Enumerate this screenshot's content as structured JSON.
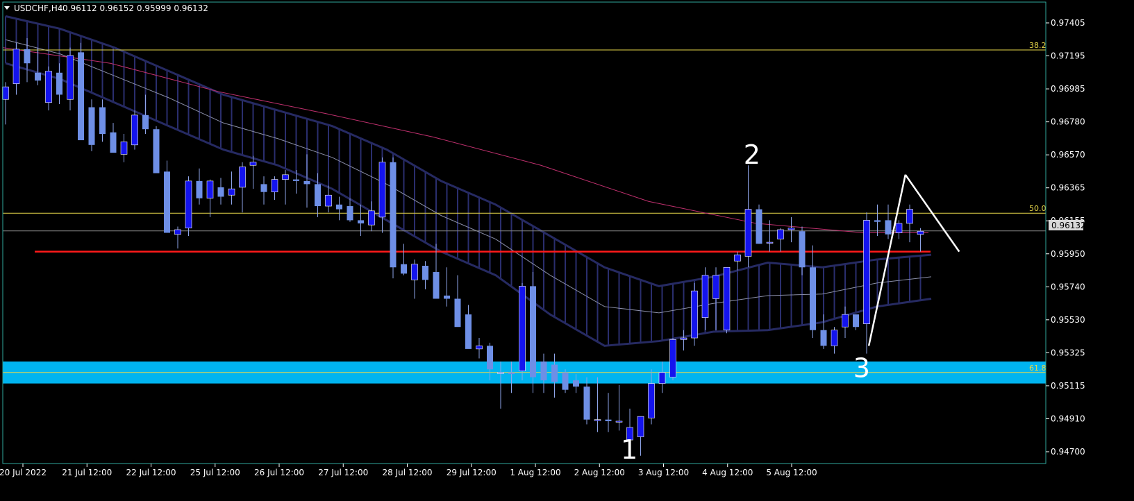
{
  "header": {
    "symbol": "USDCHF,H4",
    "prices": "0.96112 0.96152 0.95999 0.96132"
  },
  "colors": {
    "background": "#000000",
    "frame": "#2fa89b",
    "bull_candle": "#1414ee",
    "bear_candle": "#6e8fe6",
    "wick": "#8ea4e8",
    "cloud_edge": "#262a62",
    "cloud_fill": "#2a2e6e",
    "ma_line": "#c0306e",
    "fib_line": "#e8d84a",
    "support_line": "#ff1a1a",
    "zone": "#00b4f0",
    "price_line": "#8a8a8a",
    "price_badge": "#d8d8d8"
  },
  "current_price": "0.96132",
  "chart_data": {
    "type": "candlestick",
    "symbol": "USDCHF",
    "timeframe": "H4",
    "ylim": [
      0.9465,
      0.9759
    ],
    "y_ticks": [
      "0.97405",
      "0.97195",
      "0.96985",
      "0.96780",
      "0.96570",
      "0.96365",
      "0.96155",
      "0.95950",
      "0.95740",
      "0.95530",
      "0.95325",
      "0.95115",
      "0.94910",
      "0.94700"
    ],
    "x_ticks": [
      "20 Jul 2022",
      "21 Jul 12:00",
      "22 Jul 12:00",
      "25 Jul 12:00",
      "26 Jul 12:00",
      "27 Jul 12:00",
      "28 Jul 12:00",
      "29 Jul 12:00",
      "1 Aug 12:00",
      "2 Aug 12:00",
      "3 Aug 12:00",
      "4 Aug 12:00",
      "5 Aug 12:00"
    ],
    "candles": [
      {
        "o": 0.9697,
        "h": 0.9708,
        "l": 0.9681,
        "c": 0.9705
      },
      {
        "o": 0.9707,
        "h": 0.9733,
        "l": 0.97,
        "c": 0.9729
      },
      {
        "o": 0.9729,
        "h": 0.9736,
        "l": 0.9708,
        "c": 0.972
      },
      {
        "o": 0.9714,
        "h": 0.973,
        "l": 0.9706,
        "c": 0.9709
      },
      {
        "o": 0.9695,
        "h": 0.9718,
        "l": 0.969,
        "c": 0.9715
      },
      {
        "o": 0.9714,
        "h": 0.972,
        "l": 0.9694,
        "c": 0.97
      },
      {
        "o": 0.9697,
        "h": 0.973,
        "l": 0.969,
        "c": 0.9725
      },
      {
        "o": 0.9727,
        "h": 0.9733,
        "l": 0.969,
        "c": 0.9671
      },
      {
        "o": 0.9692,
        "h": 0.9697,
        "l": 0.9664,
        "c": 0.9668
      },
      {
        "o": 0.9692,
        "h": 0.9697,
        "l": 0.967,
        "c": 0.9675
      },
      {
        "o": 0.9676,
        "h": 0.9682,
        "l": 0.9664,
        "c": 0.9663
      },
      {
        "o": 0.9662,
        "h": 0.9675,
        "l": 0.9657,
        "c": 0.967
      },
      {
        "o": 0.9668,
        "h": 0.969,
        "l": 0.9665,
        "c": 0.9687
      },
      {
        "o": 0.9687,
        "h": 0.97,
        "l": 0.9675,
        "c": 0.9678
      },
      {
        "o": 0.9678,
        "h": 0.968,
        "l": 0.9654,
        "c": 0.965
      },
      {
        "o": 0.9651,
        "h": 0.9658,
        "l": 0.9626,
        "c": 0.9612
      },
      {
        "o": 0.9611,
        "h": 0.9616,
        "l": 0.9602,
        "c": 0.9614
      },
      {
        "o": 0.9615,
        "h": 0.9648,
        "l": 0.961,
        "c": 0.9645
      },
      {
        "o": 0.9645,
        "h": 0.9653,
        "l": 0.963,
        "c": 0.9634
      },
      {
        "o": 0.9634,
        "h": 0.9646,
        "l": 0.9622,
        "c": 0.9645
      },
      {
        "o": 0.9641,
        "h": 0.9647,
        "l": 0.963,
        "c": 0.9635
      },
      {
        "o": 0.9636,
        "h": 0.9651,
        "l": 0.963,
        "c": 0.964
      },
      {
        "o": 0.9641,
        "h": 0.9657,
        "l": 0.9625,
        "c": 0.9654
      },
      {
        "o": 0.9655,
        "h": 0.9661,
        "l": 0.964,
        "c": 0.9657
      },
      {
        "o": 0.9643,
        "h": 0.9648,
        "l": 0.963,
        "c": 0.9638
      },
      {
        "o": 0.9638,
        "h": 0.9648,
        "l": 0.9633,
        "c": 0.9646
      },
      {
        "o": 0.9646,
        "h": 0.9652,
        "l": 0.963,
        "c": 0.9649
      },
      {
        "o": 0.9646,
        "h": 0.9652,
        "l": 0.9637,
        "c": 0.9645
      },
      {
        "o": 0.9645,
        "h": 0.9662,
        "l": 0.9628,
        "c": 0.9643
      },
      {
        "o": 0.9643,
        "h": 0.965,
        "l": 0.9622,
        "c": 0.9629
      },
      {
        "o": 0.9629,
        "h": 0.9642,
        "l": 0.9625,
        "c": 0.9636
      },
      {
        "o": 0.963,
        "h": 0.9635,
        "l": 0.962,
        "c": 0.9627
      },
      {
        "o": 0.9629,
        "h": 0.9634,
        "l": 0.9619,
        "c": 0.962
      },
      {
        "o": 0.962,
        "h": 0.963,
        "l": 0.961,
        "c": 0.9618
      },
      {
        "o": 0.9617,
        "h": 0.9632,
        "l": 0.9613,
        "c": 0.9626
      },
      {
        "o": 0.9622,
        "h": 0.966,
        "l": 0.9612,
        "c": 0.9657
      },
      {
        "o": 0.9657,
        "h": 0.966,
        "l": 0.9583,
        "c": 0.959
      },
      {
        "o": 0.9592,
        "h": 0.9605,
        "l": 0.9585,
        "c": 0.9586
      },
      {
        "o": 0.9582,
        "h": 0.9595,
        "l": 0.957,
        "c": 0.9592
      },
      {
        "o": 0.9591,
        "h": 0.9594,
        "l": 0.9576,
        "c": 0.9582
      },
      {
        "o": 0.9587,
        "h": 0.9605,
        "l": 0.9573,
        "c": 0.957
      },
      {
        "o": 0.9572,
        "h": 0.959,
        "l": 0.9565,
        "c": 0.957
      },
      {
        "o": 0.957,
        "h": 0.9585,
        "l": 0.956,
        "c": 0.9552
      },
      {
        "o": 0.956,
        "h": 0.9566,
        "l": 0.954,
        "c": 0.9538
      },
      {
        "o": 0.9538,
        "h": 0.9545,
        "l": 0.9532,
        "c": 0.954
      },
      {
        "o": 0.954,
        "h": 0.9542,
        "l": 0.9518,
        "c": 0.9525
      },
      {
        "o": 0.9523,
        "h": 0.953,
        "l": 0.95,
        "c": 0.9523
      },
      {
        "o": 0.9523,
        "h": 0.953,
        "l": 0.951,
        "c": 0.9522
      },
      {
        "o": 0.9524,
        "h": 0.958,
        "l": 0.9518,
        "c": 0.9578
      },
      {
        "o": 0.9578,
        "h": 0.9587,
        "l": 0.951,
        "c": 0.952
      },
      {
        "o": 0.953,
        "h": 0.9535,
        "l": 0.951,
        "c": 0.9518
      },
      {
        "o": 0.9528,
        "h": 0.9535,
        "l": 0.9507,
        "c": 0.9517
      },
      {
        "o": 0.9523,
        "h": 0.9525,
        "l": 0.951,
        "c": 0.9512
      },
      {
        "o": 0.9518,
        "h": 0.9522,
        "l": 0.951,
        "c": 0.9514
      },
      {
        "o": 0.9514,
        "h": 0.952,
        "l": 0.949,
        "c": 0.9493
      },
      {
        "o": 0.9493,
        "h": 0.952,
        "l": 0.9485,
        "c": 0.9493
      },
      {
        "o": 0.9493,
        "h": 0.951,
        "l": 0.9485,
        "c": 0.9492
      },
      {
        "o": 0.9492,
        "h": 0.9515,
        "l": 0.9486,
        "c": 0.9492
      },
      {
        "o": 0.948,
        "h": 0.95,
        "l": 0.9477,
        "c": 0.9488
      },
      {
        "o": 0.9482,
        "h": 0.9495,
        "l": 0.947,
        "c": 0.9495
      },
      {
        "o": 0.9494,
        "h": 0.9525,
        "l": 0.949,
        "c": 0.9516
      },
      {
        "o": 0.9516,
        "h": 0.953,
        "l": 0.951,
        "c": 0.9523
      },
      {
        "o": 0.952,
        "h": 0.9545,
        "l": 0.9518,
        "c": 0.9544
      },
      {
        "o": 0.9544,
        "h": 0.955,
        "l": 0.9537,
        "c": 0.9545
      },
      {
        "o": 0.9545,
        "h": 0.958,
        "l": 0.954,
        "c": 0.9575
      },
      {
        "o": 0.9558,
        "h": 0.959,
        "l": 0.955,
        "c": 0.9585
      },
      {
        "o": 0.957,
        "h": 0.959,
        "l": 0.955,
        "c": 0.9585
      },
      {
        "o": 0.955,
        "h": 0.959,
        "l": 0.9548,
        "c": 0.959
      },
      {
        "o": 0.9594,
        "h": 0.96,
        "l": 0.9588,
        "c": 0.9598
      },
      {
        "o": 0.9597,
        "h": 0.9655,
        "l": 0.959,
        "c": 0.9627
      },
      {
        "o": 0.9627,
        "h": 0.963,
        "l": 0.9605,
        "c": 0.9605
      },
      {
        "o": 0.9606,
        "h": 0.962,
        "l": 0.96,
        "c": 0.9606
      },
      {
        "o": 0.9608,
        "h": 0.9615,
        "l": 0.96,
        "c": 0.9614
      },
      {
        "o": 0.9614,
        "h": 0.9622,
        "l": 0.9606,
        "c": 0.9615
      },
      {
        "o": 0.9613,
        "h": 0.9616,
        "l": 0.9585,
        "c": 0.959
      },
      {
        "o": 0.959,
        "h": 0.9604,
        "l": 0.9545,
        "c": 0.955
      },
      {
        "o": 0.955,
        "h": 0.956,
        "l": 0.9538,
        "c": 0.954
      },
      {
        "o": 0.954,
        "h": 0.9552,
        "l": 0.9535,
        "c": 0.955
      },
      {
        "o": 0.9552,
        "h": 0.9565,
        "l": 0.9545,
        "c": 0.956
      },
      {
        "o": 0.956,
        "h": 0.956,
        "l": 0.955,
        "c": 0.9552
      },
      {
        "o": 0.9554,
        "h": 0.9625,
        "l": 0.9535,
        "c": 0.962
      },
      {
        "o": 0.962,
        "h": 0.963,
        "l": 0.961,
        "c": 0.9619
      },
      {
        "o": 0.962,
        "h": 0.963,
        "l": 0.9608,
        "c": 0.9611
      },
      {
        "o": 0.9612,
        "h": 0.962,
        "l": 0.9608,
        "c": 0.9618
      },
      {
        "o": 0.9618,
        "h": 0.963,
        "l": 0.9606,
        "c": 0.9627
      },
      {
        "o": 0.9611,
        "h": 0.9615,
        "l": 0.96,
        "c": 0.9613
      }
    ],
    "cloud": [
      {
        "u": 0.975,
        "l": 0.972,
        "m": 0.9735
      },
      {
        "u": 0.9742,
        "l": 0.971,
        "m": 0.9726
      },
      {
        "u": 0.973,
        "l": 0.9695,
        "m": 0.9712
      },
      {
        "u": 0.9715,
        "l": 0.968,
        "m": 0.9698
      },
      {
        "u": 0.97,
        "l": 0.9665,
        "m": 0.9682
      },
      {
        "u": 0.969,
        "l": 0.9655,
        "m": 0.9672
      },
      {
        "u": 0.968,
        "l": 0.964,
        "m": 0.966
      },
      {
        "u": 0.9665,
        "l": 0.962,
        "m": 0.9643
      },
      {
        "u": 0.9645,
        "l": 0.96,
        "m": 0.9623
      },
      {
        "u": 0.963,
        "l": 0.9585,
        "m": 0.9608
      },
      {
        "u": 0.961,
        "l": 0.956,
        "m": 0.9585
      },
      {
        "u": 0.959,
        "l": 0.954,
        "m": 0.9565
      },
      {
        "u": 0.9578,
        "l": 0.9543,
        "m": 0.9561
      },
      {
        "u": 0.9584,
        "l": 0.9549,
        "m": 0.9567
      },
      {
        "u": 0.9593,
        "l": 0.955,
        "m": 0.9572
      },
      {
        "u": 0.959,
        "l": 0.9555,
        "m": 0.9573
      },
      {
        "u": 0.9595,
        "l": 0.9565,
        "m": 0.958
      },
      {
        "u": 0.9598,
        "l": 0.957,
        "m": 0.9584
      }
    ],
    "ma": [
      {
        "i": 0,
        "v": 0.973
      },
      {
        "i": 10,
        "v": 0.972
      },
      {
        "i": 20,
        "v": 0.9702
      },
      {
        "i": 30,
        "v": 0.9688
      },
      {
        "i": 40,
        "v": 0.9673
      },
      {
        "i": 50,
        "v": 0.9655
      },
      {
        "i": 60,
        "v": 0.9632
      },
      {
        "i": 70,
        "v": 0.9618
      },
      {
        "i": 80,
        "v": 0.9612
      },
      {
        "i": 86,
        "v": 0.9612
      }
    ],
    "fib_levels": [
      {
        "label": "38.2",
        "price": 0.97285
      },
      {
        "label": "50.0",
        "price": 0.96245
      },
      {
        "label": "61.8",
        "price": 0.9523
      }
    ],
    "support_line": {
      "price": 0.96
    },
    "zone": {
      "top": 0.953,
      "bottom": 0.9516
    },
    "wave_lines": [
      {
        "x1": 80.2,
        "y1": 0.954,
        "x2": 83.6,
        "y2": 0.9649
      },
      {
        "x1": 83.6,
        "y1": 0.9649,
        "x2": 88.6,
        "y2": 0.96
      }
    ],
    "wave_labels": [
      {
        "text": "1",
        "i": 58.2,
        "price": 0.9468
      },
      {
        "text": "2",
        "i": 69.6,
        "price": 0.9656
      },
      {
        "text": "3",
        "i": 79.8,
        "price": 0.952
      }
    ]
  }
}
